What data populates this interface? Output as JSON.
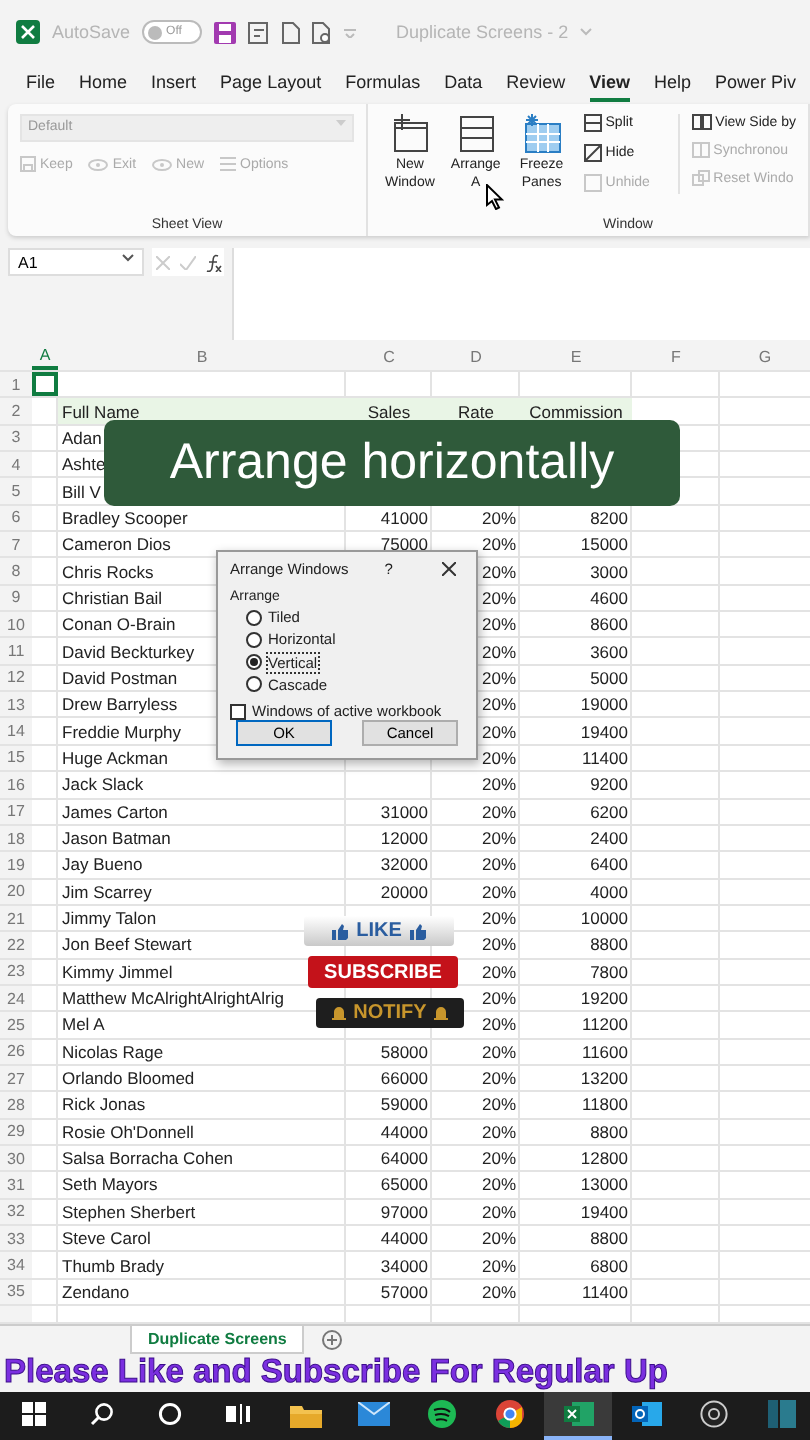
{
  "title_bar": {
    "autosave_label": "AutoSave",
    "autosave_on": false,
    "autosave_state": "Off",
    "document_title": "Duplicate Screens - 2"
  },
  "ribbon_tabs": [
    {
      "label": "File",
      "selected": false
    },
    {
      "label": "Home",
      "selected": false
    },
    {
      "label": "Insert",
      "selected": false
    },
    {
      "label": "Page Layout",
      "selected": false
    },
    {
      "label": "Formulas",
      "selected": false
    },
    {
      "label": "Data",
      "selected": false
    },
    {
      "label": "Review",
      "selected": false
    },
    {
      "label": "View",
      "selected": true
    },
    {
      "label": "Help",
      "selected": false
    },
    {
      "label": "Power Piv",
      "selected": false
    }
  ],
  "sheet_view": {
    "style_value": "Default",
    "disabled": true,
    "buttons": [
      {
        "label": "Keep",
        "kind": "keep"
      },
      {
        "label": "Exit",
        "kind": "exit"
      },
      {
        "label": "New",
        "kind": "new"
      },
      {
        "label": "Options",
        "kind": "options"
      }
    ],
    "group_label": "Sheet View"
  },
  "window_group": {
    "large_buttons": [
      {
        "label": "New Window",
        "kind": "new-window"
      },
      {
        "label": "Arrange A",
        "kind": "arrange"
      },
      {
        "label": "Freeze Panes",
        "kind": "freeze"
      }
    ],
    "small_buttons": [
      {
        "label": "Split",
        "kind": "split",
        "disabled": false
      },
      {
        "label": "Hide",
        "kind": "hide",
        "disabled": false
      },
      {
        "label": "Unhide",
        "kind": "unhide",
        "disabled": true
      }
    ],
    "side_buttons": [
      {
        "label": "View Side by",
        "kind": "side",
        "disabled": false
      },
      {
        "label": "Synchronou",
        "kind": "sync",
        "disabled": true
      },
      {
        "label": "Reset Windo",
        "kind": "reset",
        "disabled": true
      }
    ],
    "group_label": "Window"
  },
  "formula_bar": {
    "name_box": "A1"
  },
  "columns": [
    "A",
    "B",
    "C",
    "D",
    "E",
    "F",
    "G"
  ],
  "rows": [
    {
      "number": "1"
    },
    {
      "number": "2",
      "name": "Full Name",
      "sales": "Sales",
      "rate": "Rate",
      "commission": "Commission",
      "header": true
    },
    {
      "number": "3",
      "name": "Adan"
    },
    {
      "number": "4",
      "name": "Ashte"
    },
    {
      "number": "5",
      "name": "Bill V"
    },
    {
      "number": "6",
      "name": "Bradley Scooper",
      "sales": "41000",
      "rate": "20%",
      "commission": "8200"
    },
    {
      "number": "7",
      "name": "Cameron Dios",
      "sales": "75000",
      "rate": "20%",
      "commission": "15000"
    },
    {
      "number": "8",
      "name": "Chris Rocks",
      "rate": "20%",
      "commission": "3000"
    },
    {
      "number": "9",
      "name": "Christian Bail",
      "rate": "20%",
      "commission": "4600"
    },
    {
      "number": "10",
      "name": "Conan O-Brain",
      "rate": "20%",
      "commission": "8600"
    },
    {
      "number": "11",
      "name": "David Beckturkey",
      "rate": "20%",
      "commission": "3600"
    },
    {
      "number": "12",
      "name": "David Postman",
      "rate": "20%",
      "commission": "5000"
    },
    {
      "number": "13",
      "name": "Drew Barryless",
      "rate": "20%",
      "commission": "19000"
    },
    {
      "number": "14",
      "name": "Freddie Murphy",
      "rate": "20%",
      "commission": "19400"
    },
    {
      "number": "15",
      "name": "Huge Ackman",
      "rate": "20%",
      "commission": "11400"
    },
    {
      "number": "16",
      "name": "Jack Slack",
      "rate": "20%",
      "commission": "9200"
    },
    {
      "number": "17",
      "name": "James Carton",
      "sales": "31000",
      "rate": "20%",
      "commission": "6200"
    },
    {
      "number": "18",
      "name": "Jason Batman",
      "sales": "12000",
      "rate": "20%",
      "commission": "2400"
    },
    {
      "number": "19",
      "name": "Jay Bueno",
      "sales": "32000",
      "rate": "20%",
      "commission": "6400"
    },
    {
      "number": "20",
      "name": "Jim Scarrey",
      "sales": "20000",
      "rate": "20%",
      "commission": "4000"
    },
    {
      "number": "21",
      "name": "Jimmy Talon",
      "rate": "20%",
      "commission": "10000"
    },
    {
      "number": "22",
      "name": "Jon Beef Stewart",
      "rate": "20%",
      "commission": "8800"
    },
    {
      "number": "23",
      "name": "Kimmy Jimmel",
      "rate": "20%",
      "commission": "7800"
    },
    {
      "number": "24",
      "name": "Matthew McAlrightAlrightAlrig",
      "rate": "20%",
      "commission": "19200"
    },
    {
      "number": "25",
      "name": "Mel A",
      "rate": "20%",
      "commission": "11200"
    },
    {
      "number": "26",
      "name": "Nicolas Rage",
      "sales": "58000",
      "rate": "20%",
      "commission": "11600"
    },
    {
      "number": "27",
      "name": "Orlando Bloomed",
      "sales": "66000",
      "rate": "20%",
      "commission": "13200"
    },
    {
      "number": "28",
      "name": "Rick Jonas",
      "sales": "59000",
      "rate": "20%",
      "commission": "11800"
    },
    {
      "number": "29",
      "name": "Rosie Oh'Donnell",
      "sales": "44000",
      "rate": "20%",
      "commission": "8800"
    },
    {
      "number": "30",
      "name": "Salsa Borracha Cohen",
      "sales": "64000",
      "rate": "20%",
      "commission": "12800"
    },
    {
      "number": "31",
      "name": "Seth Mayors",
      "sales": "65000",
      "rate": "20%",
      "commission": "13000"
    },
    {
      "number": "32",
      "name": "Stephen Sherbert",
      "sales": "97000",
      "rate": "20%",
      "commission": "19400"
    },
    {
      "number": "33",
      "name": "Steve Carol",
      "sales": "44000",
      "rate": "20%",
      "commission": "8800"
    },
    {
      "number": "34",
      "name": "Thumb Brady",
      "sales": "34000",
      "rate": "20%",
      "commission": "6800"
    },
    {
      "number": "35",
      "name": "Zendano",
      "sales": "57000",
      "rate": "20%",
      "commission": "11400"
    }
  ],
  "dialog": {
    "title": "Arrange Windows",
    "help": "?",
    "group_label": "Arrange",
    "options": [
      {
        "label": "Tiled",
        "selected": false
      },
      {
        "label": "Horizontal",
        "selected": false
      },
      {
        "label": "Vertical",
        "selected": true
      },
      {
        "label": "Cascade",
        "selected": false
      }
    ],
    "checkbox": {
      "label": "Windows of active workbook",
      "checked": false
    },
    "buttons": [
      "OK",
      "Cancel"
    ]
  },
  "caption": "Arrange horizontally",
  "promo": {
    "like": "LIKE",
    "subscribe": "SUBSCRIBE",
    "notify": "NOTIFY"
  },
  "sheet_tabs": [
    {
      "label": "Duplicate Screens",
      "selected": true
    }
  ],
  "banner": "Please Like and Subscribe For Regular Up",
  "taskbar": [
    {
      "kind": "start",
      "selected": false
    },
    {
      "kind": "search",
      "selected": false
    },
    {
      "kind": "cortana",
      "selected": false
    },
    {
      "kind": "taskview",
      "selected": false
    },
    {
      "kind": "files",
      "selected": false
    },
    {
      "kind": "mail",
      "selected": false
    },
    {
      "kind": "music",
      "selected": false
    },
    {
      "kind": "browser",
      "selected": false
    },
    {
      "kind": "excel",
      "selected": true
    },
    {
      "kind": "outlook",
      "selected": false
    },
    {
      "kind": "recorder",
      "selected": false
    },
    {
      "kind": "panel",
      "selected": false
    }
  ]
}
